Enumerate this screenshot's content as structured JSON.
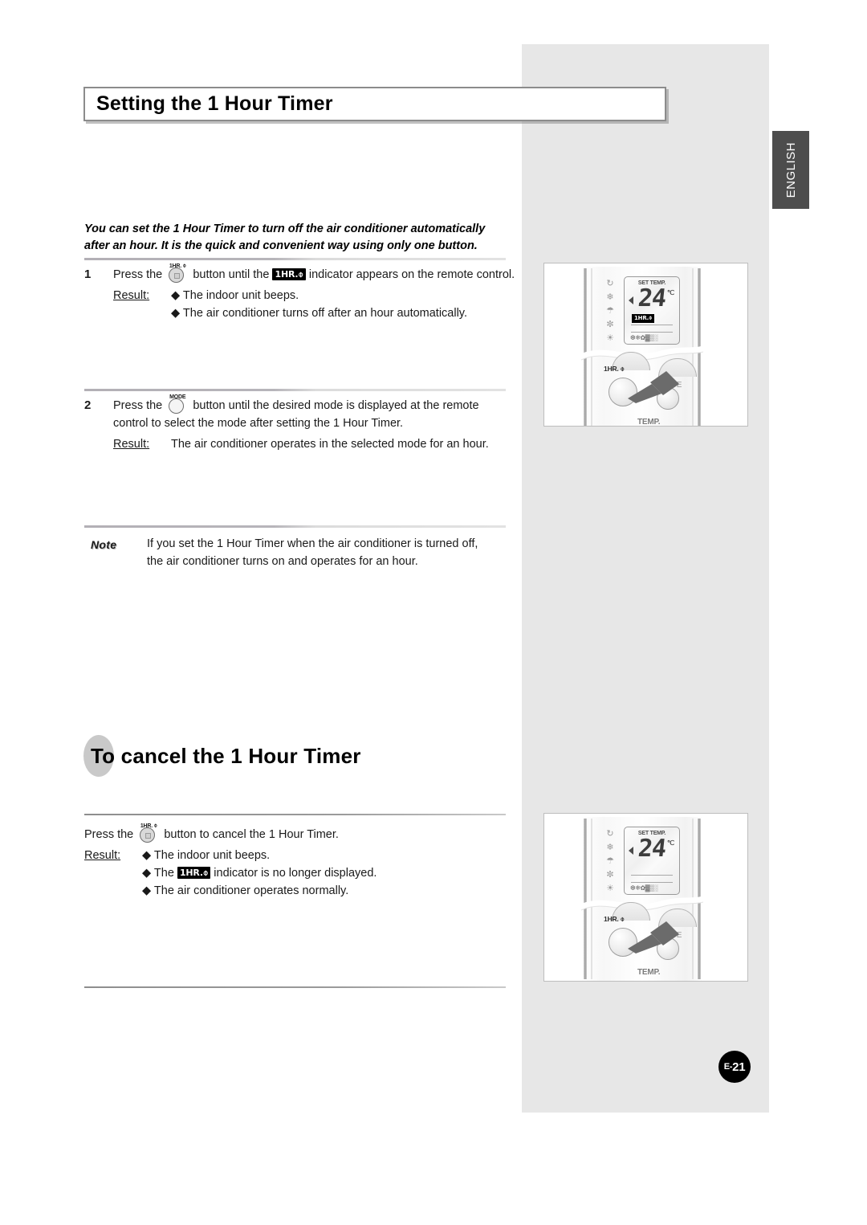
{
  "page": {
    "language_tab": "ENGLISH",
    "page_number": "E-21",
    "page_number_prefix": "E-",
    "page_number_value": "21"
  },
  "heading": {
    "title": "Setting the 1 Hour Timer"
  },
  "intro": {
    "line1": "You can set the 1 Hour Timer to turn off the air conditioner automatically",
    "line2": "after an hour. It is the quick and convenient way using only one button."
  },
  "steps": [
    {
      "number": "1",
      "text_before_button": "Press the",
      "button_caption": "1HR. ⌽",
      "text_after_button": "button until the",
      "badge": "1HR.⌽",
      "text_after_badge": "indicator appears on the remote control.",
      "result_label": "Result:",
      "results": [
        "◆ The indoor unit beeps.",
        "◆ The air conditioner turns off after an hour automatically."
      ]
    },
    {
      "number": "2",
      "text_before_button": "Press the",
      "button_caption": "MODE",
      "text_after_button": "button until the desired mode is displayed at the remote",
      "text_line2": "control to select the mode after setting the 1 Hour Timer.",
      "result_label": "Result:",
      "results": [
        "The air conditioner operates in the selected mode for an hour."
      ]
    }
  ],
  "note": {
    "label": "Note",
    "line1": "If you set the 1 Hour Timer when the air conditioner is turned off,",
    "line2": "the air conditioner turns on and operates for an hour."
  },
  "subheading": {
    "title": "To cancel the 1 Hour Timer"
  },
  "cancel": {
    "text_before_button": "Press the",
    "button_caption": "1HR. ⌽",
    "text_after_button": "button to cancel the 1 Hour Timer.",
    "result_label": "Result:",
    "result_1": "◆ The indoor unit beeps.",
    "result_2_before": "◆ The",
    "result_2_badge": "1HR.⌽",
    "result_2_after": "indicator is no longer displayed.",
    "result_3": "◆ The air conditioner operates normally."
  },
  "illustration_top": {
    "lcd_label": "SET TEMP.",
    "lcd_value": "24",
    "lcd_unit": "℃",
    "lcd_timer_badge": "1HR.⌽",
    "lcd_foot_icons": "❆❄✿▓▒░",
    "mode_icons": [
      "auto-mode-icon",
      "cool-mode-icon",
      "dry-mode-icon",
      "fan-mode-icon",
      "heat-mode-icon"
    ],
    "mode_glyphs": [
      "↻",
      "❄",
      "☂",
      "✼",
      "☀"
    ],
    "button_1hr_label": "1HR. ⌽",
    "button_mode_label": "MODE",
    "button_temp_label": "TEMP."
  },
  "illustration_bottom": {
    "lcd_label": "SET TEMP.",
    "lcd_value": "24",
    "lcd_unit": "℃",
    "lcd_timer_badge": "",
    "lcd_foot_icons": "❆❄✿▓▒░",
    "mode_glyphs": [
      "↻",
      "❄",
      "☂",
      "✼",
      "☀"
    ],
    "button_1hr_label": "1HR. ⌽",
    "button_mode_label": "MODE",
    "button_temp_label": "TEMP."
  },
  "colors": {
    "panel_grey": "#e7e7e7",
    "tab_dark": "#4d4d4d",
    "badge_black": "#000000"
  }
}
